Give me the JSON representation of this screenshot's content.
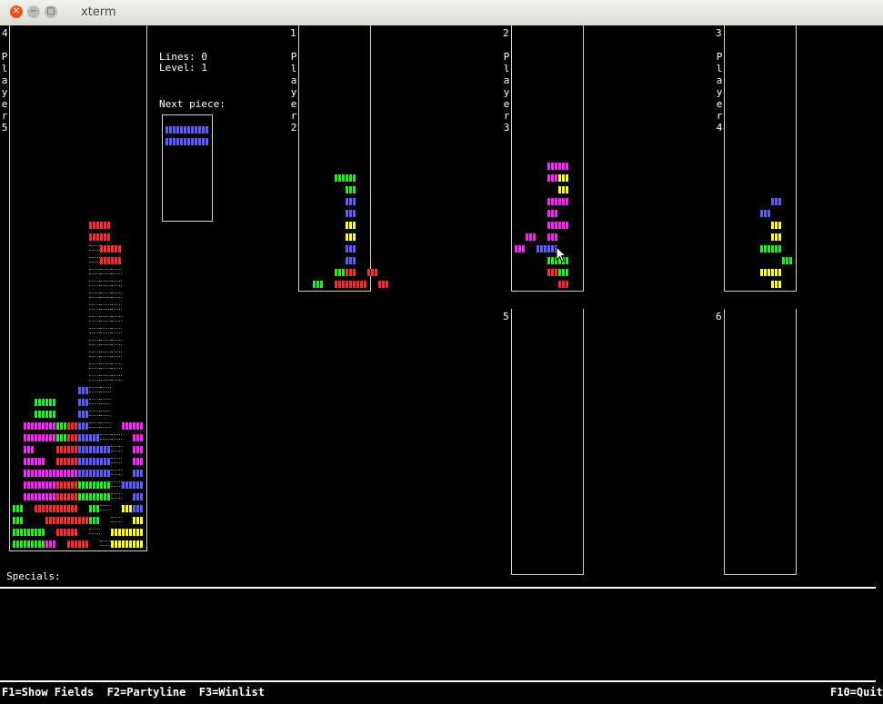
{
  "window": {
    "title": "xterm"
  },
  "info": {
    "lines": "Lines: 0",
    "level": "Level: 1",
    "next_piece": "Next piece:",
    "specials": "Specials:"
  },
  "fields": [
    {
      "id": "main",
      "number": "4",
      "vertical_label": "Player5"
    },
    {
      "id": "p1",
      "number": "1",
      "vertical_label": "Player2"
    },
    {
      "id": "p2",
      "number": "2",
      "vertical_label": "Player3"
    },
    {
      "id": "p3",
      "number": "3",
      "vertical_label": "Player4"
    },
    {
      "id": "p5",
      "number": "5",
      "vertical_label": ""
    },
    {
      "id": "p6",
      "number": "6",
      "vertical_label": ""
    }
  ],
  "colors": {
    "r": "#ff2a2a",
    "g": "#22ee22",
    "b": "#5c5cff",
    "m": "#ff22ff",
    "y": "#ffff22",
    "d": "#777777"
  },
  "boards": {
    "main": [
      "........................",
      "........................",
      "........................",
      "........................",
      "........................",
      "........................",
      "........................",
      "........................",
      "........................",
      "........................",
      "........................",
      "........................",
      "........................",
      "........................",
      ".......rr...",
      ".......rr...",
      ".......drr..",
      ".......drr..",
      ".......ddd..",
      ".......ddd..",
      ".......ddd..",
      ".......ddd..",
      ".......ddd..",
      ".......ddd..",
      ".......ddd..",
      ".......ddd..",
      ".......ddd..",
      ".......ddd..",
      "......bdd...",
      "..gg..bdd...",
      "..gg..bdd...",
      ".mmmgrbdd.mm",
      ".mmmgrbbdd.m",
      ".m..rrbbbd.m",
      ".mm.rrbbbd.m",
      ".mmmmmbbbd.b",
      ".mmmrrgggdbb",
      ".mmmrrgggd.b",
      "g.rrrr.gd.yb",
      "g..rrrrg.d.y",
      "ggg.rr.d.yyy",
      "gggm.rr.dyyy"
    ],
    "p1": [
      "......",
      "......",
      "......",
      "......",
      "......",
      "......",
      "......",
      "......",
      "......",
      "......",
      "......",
      "......",
      "...gg.",
      "....g.",
      "....b.",
      "....b.",
      "....y.",
      "....y.",
      "....b.",
      "....b.",
      "...gr.r",
      ".g.rrr.r"
    ],
    "p2": [
      "......",
      "......",
      "......",
      "......",
      "......",
      "......",
      "......",
      "......",
      "......",
      "......",
      "...mm.",
      "...my.",
      "....y.",
      "...mm.",
      "...m..",
      "...mm.",
      ".m.m..",
      "m.bb..",
      "...gg.",
      "...rg.",
      "....r."
    ],
    "p3": [
      "......",
      "......",
      "......",
      "......",
      "......",
      "......",
      "......",
      "......",
      "......",
      "......",
      "......",
      "......",
      "....b.",
      "...b..",
      "....y.",
      "....y.",
      "...gg.",
      ".....g",
      "...yy.",
      "....y."
    ],
    "next": [
      "bbbb",
      "bbbb"
    ]
  },
  "status_bar": {
    "left": "F1=Show Fields  F2=Partyline  F3=Winlist",
    "right": "F10=Quit"
  }
}
